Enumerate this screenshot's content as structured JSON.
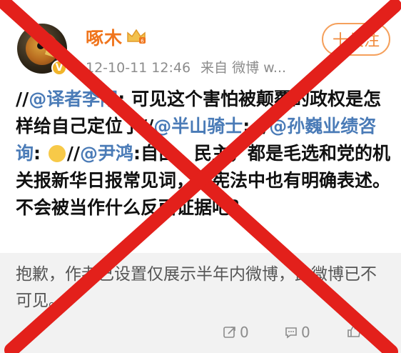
{
  "post": {
    "username": "啄木",
    "timestamp": "12-10-11 12:46",
    "source": "来自 微博 w...",
    "follow_label": "十关注",
    "content": {
      "prefix1": "//",
      "mention1": "@译者李阳",
      "text1": ": 可见这个害怕被颠覆的政权是怎样给自己定位了",
      "prefix2": "//",
      "mention2": "@半山骑士",
      "text2": ": ",
      "prefix3": "//",
      "mention3": "@孙巍业绩咨询",
      "text3": ": ",
      "prefix4": "//",
      "mention4": "@尹鸿",
      "text4": ":自由，民主，都是毛选和党的机关报新华日报常见词，本宪法中也有明确表述。不会被当作什么反面证据吧？"
    }
  },
  "notice": {
    "text": "抱歉，作者已设置仅展示半年内微博，此微博已不可见。"
  },
  "actions": {
    "repost_count": "0",
    "comment_count": "0",
    "like_count": ""
  },
  "colors": {
    "username": "#f0751d",
    "mention": "#4a7bb7",
    "cross": "#e3201b"
  },
  "icons": [
    "avatar-bird",
    "verified-icon",
    "crown-icon",
    "repost-icon",
    "comment-icon",
    "like-icon"
  ]
}
